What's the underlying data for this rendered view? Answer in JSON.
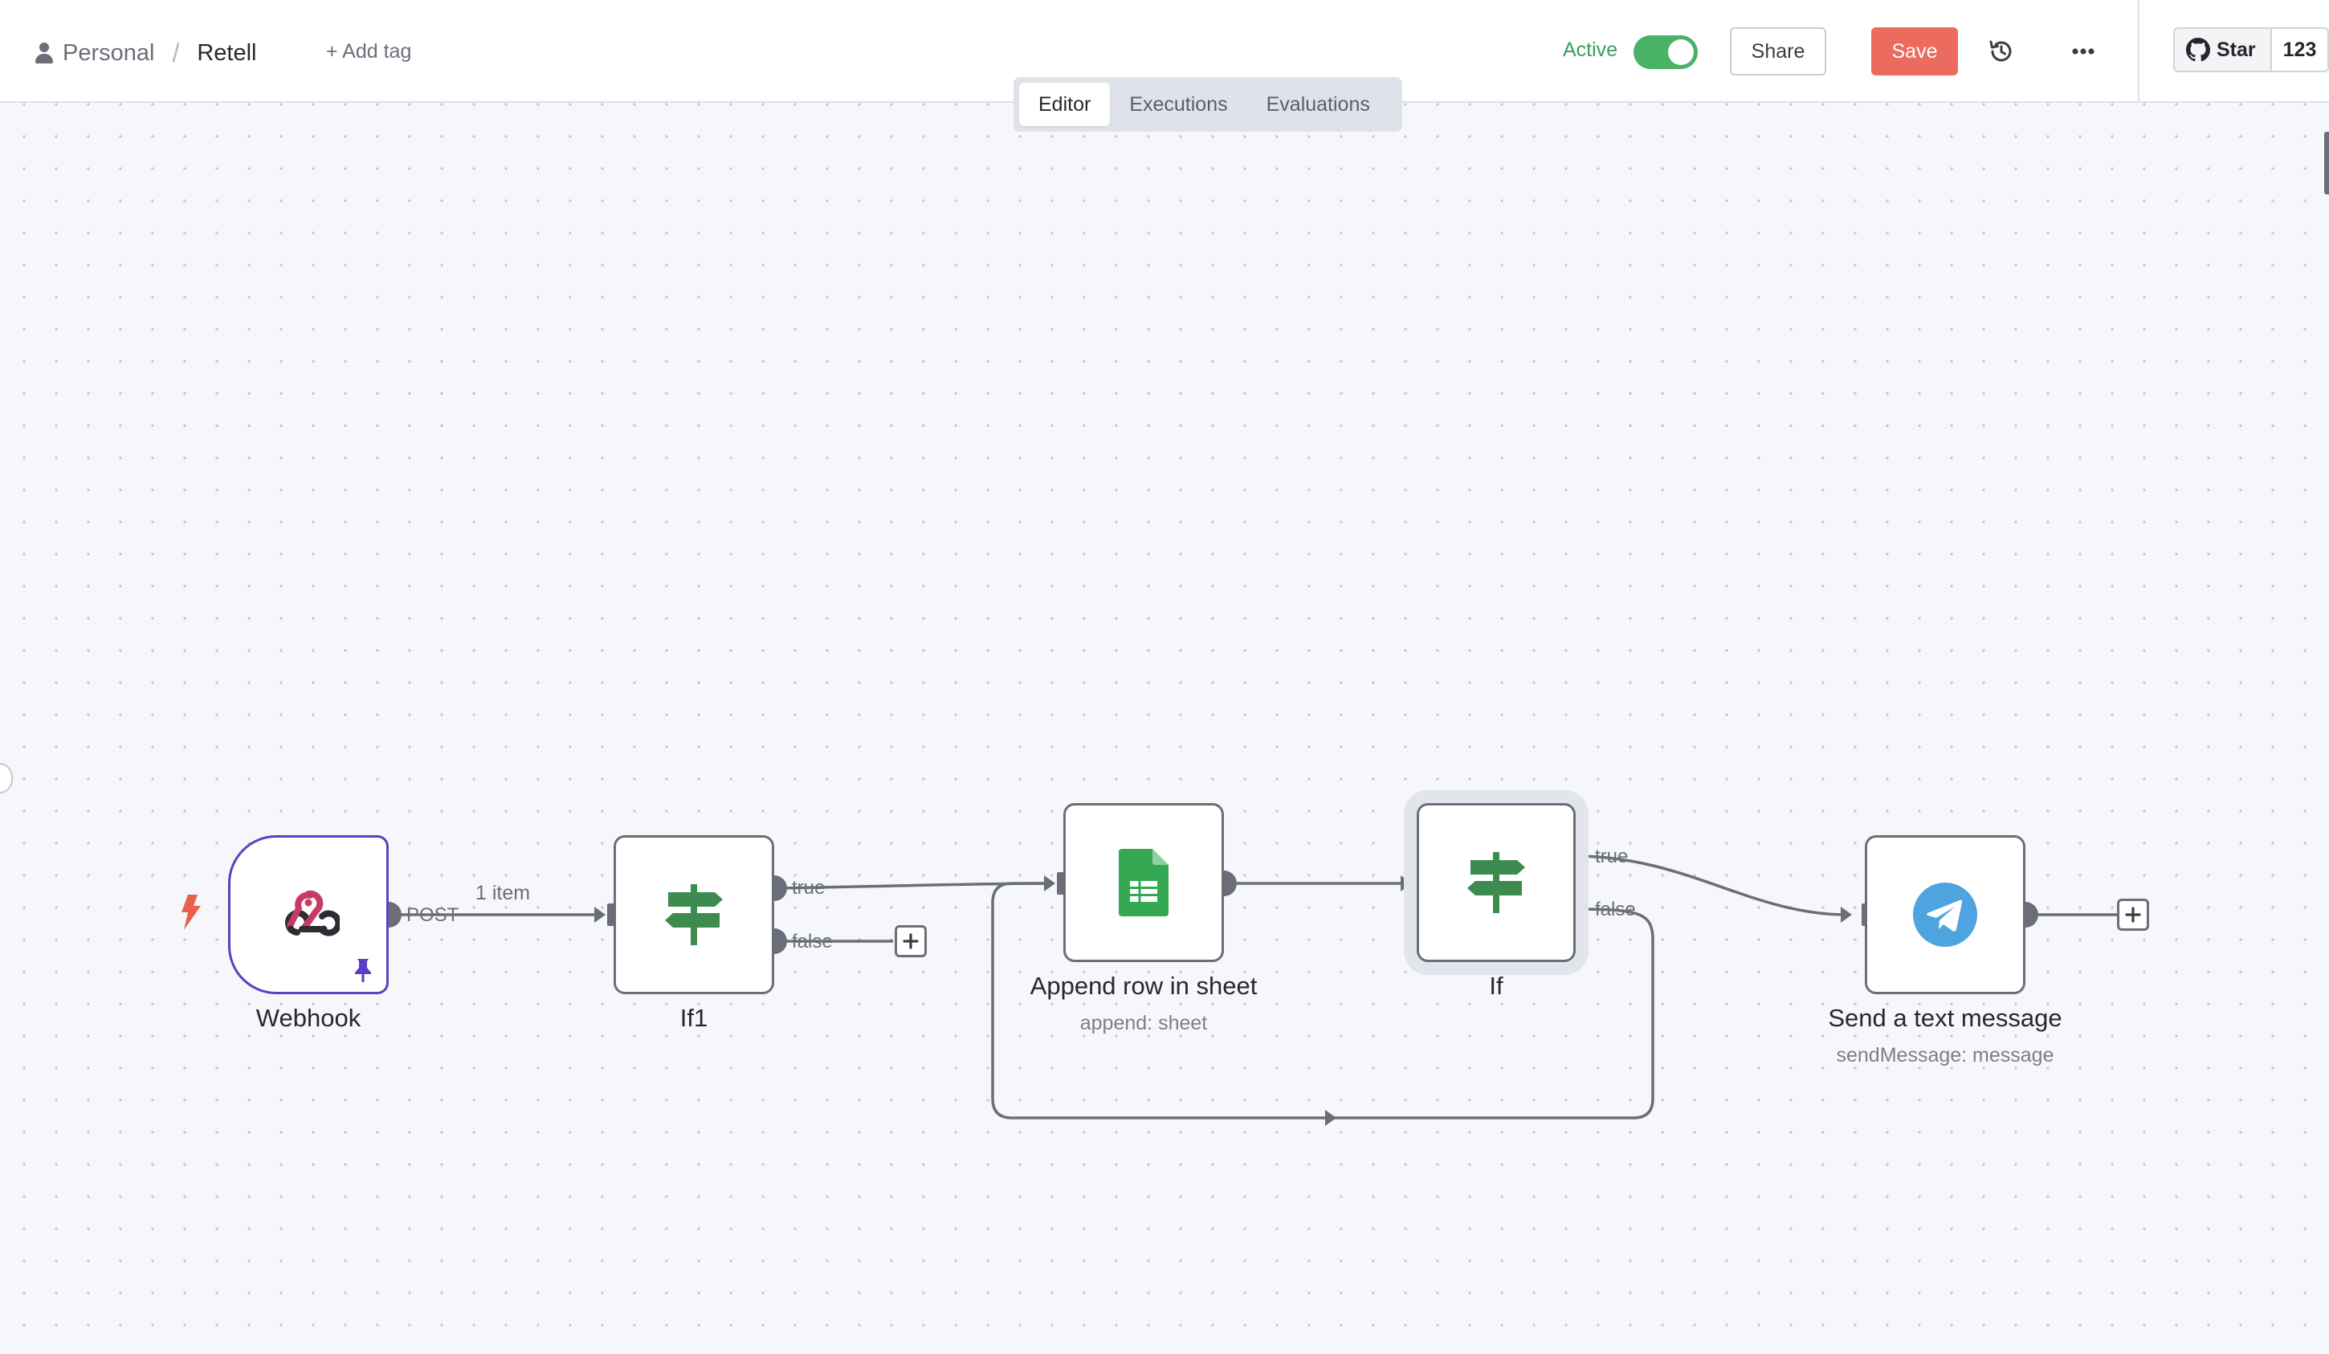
{
  "header": {
    "project": "Personal",
    "workflow_name": "Retell",
    "add_tag": "+ Add tag",
    "tabs": [
      "Editor",
      "Executions",
      "Evaluations"
    ],
    "active_tab": "Editor",
    "active_label": "Active",
    "active_on": true,
    "share_label": "Share",
    "save_label": "Save",
    "github_star_label": "Star",
    "github_star_count": "123"
  },
  "colors": {
    "save": "#eb6b5e",
    "active": "#48b267",
    "webhook_border": "#5b3fc4",
    "trigger": "#e8604c",
    "if_icon": "#3d8b4f",
    "sheets": "#34a853",
    "telegram": "#4ea4de"
  },
  "nodes": [
    {
      "name": "Webhook",
      "subtitle": "",
      "icon": "webhook-icon",
      "pinned": true
    },
    {
      "name": "If1",
      "subtitle": "",
      "icon": "signpost-icon"
    },
    {
      "name": "Append row in sheet",
      "subtitle": "append: sheet",
      "icon": "google-sheets-icon"
    },
    {
      "name": "If",
      "subtitle": "",
      "icon": "signpost-icon",
      "selected": true
    },
    {
      "name": "Send a text message",
      "subtitle": "sendMessage: message",
      "icon": "telegram-icon"
    }
  ],
  "edges": {
    "webhook_output": "POST",
    "webhook_items": "1 item",
    "true_label": "true",
    "false_label": "false"
  }
}
